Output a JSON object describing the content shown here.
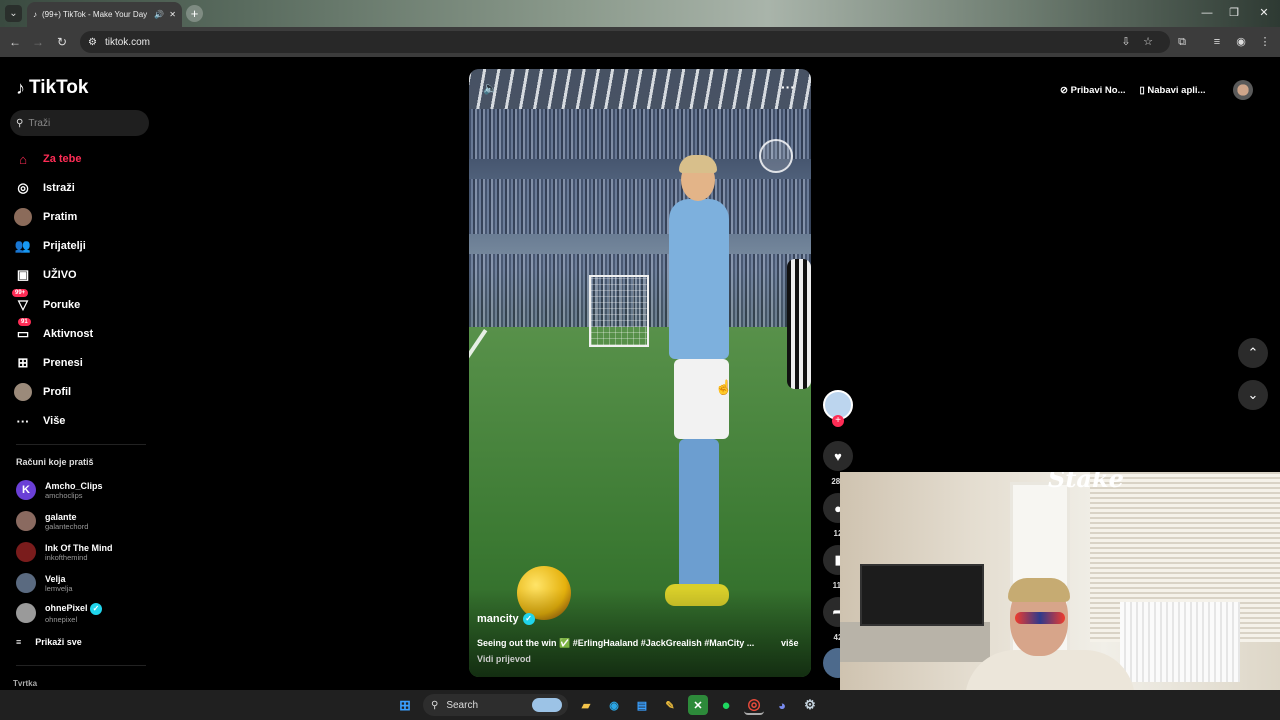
{
  "browser": {
    "tab_title": "(99+) TikTok - Make Your Day",
    "url": "tiktok.com",
    "tab_icon": "tiktok-icon",
    "tab_audio_icon": "speaker-icon"
  },
  "sidebar": {
    "logo": "TikTok",
    "search_placeholder": "Traži",
    "nav": [
      {
        "label": "Za tebe",
        "icon": "home-icon",
        "active": true
      },
      {
        "label": "Istraži",
        "icon": "compass-icon"
      },
      {
        "label": "Pratim",
        "icon": "avatar-icon"
      },
      {
        "label": "Prijatelji",
        "icon": "friends-icon"
      },
      {
        "label": "UŽIVO",
        "icon": "live-icon"
      },
      {
        "label": "Poruke",
        "icon": "messages-icon",
        "badge": "99+"
      },
      {
        "label": "Aktivnost",
        "icon": "activity-icon",
        "badge": "91"
      },
      {
        "label": "Prenesi",
        "icon": "upload-icon"
      },
      {
        "label": "Profil",
        "icon": "profile-icon"
      },
      {
        "label": "Više",
        "icon": "more-icon"
      }
    ],
    "following_title": "Računi koje pratiš",
    "accounts": [
      {
        "name": "Amcho_Clips",
        "handle": "amchoclips",
        "color": "#6a3fd6"
      },
      {
        "name": "galante",
        "handle": "galantechord",
        "color": "#8a6a60"
      },
      {
        "name": "Ink Of The Mind",
        "handle": "inkofthemind",
        "color": "#7a1c1c"
      },
      {
        "name": "Velja",
        "handle": "lemvelja",
        "color": "#5a6a80"
      },
      {
        "name": "ohnePixel",
        "handle": "ohnepixel",
        "color": "#9a9a9a",
        "verified": true
      }
    ],
    "show_all": "Prikaži sve",
    "company": "Tvrtka"
  },
  "video": {
    "author": "mancity",
    "caption": "Seeing out the win ✅ #ErlingHaaland #JackGrealish #ManCity ...",
    "more": "više",
    "translate": "Vidi prijevod"
  },
  "actions": {
    "likes": "283",
    "comments": "12",
    "saves": "11.",
    "shares": "42"
  },
  "topbar": {
    "get_coins": "Pribavi No...",
    "get_app": "Nabavi apli..."
  },
  "webcam": {
    "overlay_logo": "Stake"
  },
  "taskbar": {
    "search_label": "Search"
  },
  "colors": {
    "accent": "#fe2c55",
    "background": "#000000"
  }
}
